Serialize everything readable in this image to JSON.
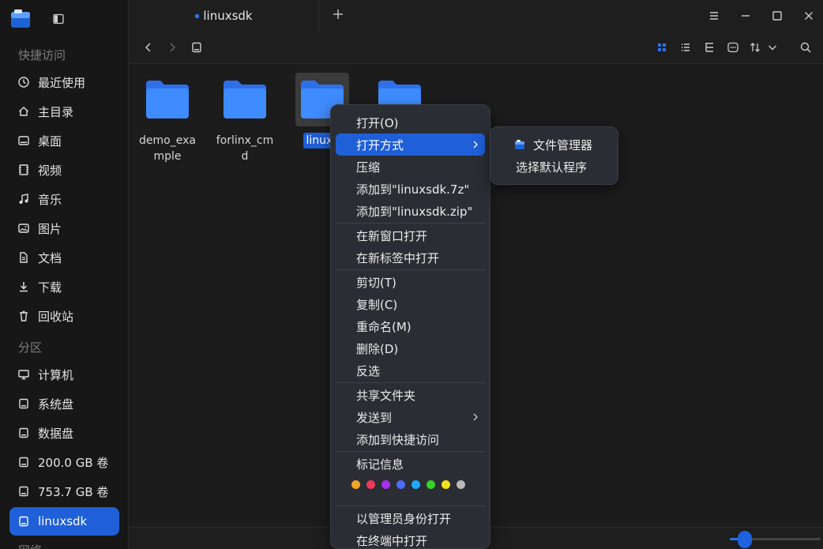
{
  "sidebar": {
    "section_quick": "快捷访问",
    "section_partition": "分区",
    "section_network": "网络",
    "quick_items": [
      {
        "label": "最近使用",
        "icon": "clock-icon"
      },
      {
        "label": "主目录",
        "icon": "home-icon"
      },
      {
        "label": "桌面",
        "icon": "desktop-icon"
      },
      {
        "label": "视频",
        "icon": "video-icon"
      },
      {
        "label": "音乐",
        "icon": "music-icon"
      },
      {
        "label": "图片",
        "icon": "image-icon"
      },
      {
        "label": "文档",
        "icon": "document-icon"
      },
      {
        "label": "下载",
        "icon": "download-icon"
      },
      {
        "label": "回收站",
        "icon": "trash-icon"
      }
    ],
    "partition_items": [
      {
        "label": "计算机",
        "icon": "computer-icon"
      },
      {
        "label": "系统盘",
        "icon": "disk-icon"
      },
      {
        "label": "数据盘",
        "icon": "disk-icon"
      },
      {
        "label": "200.0 GB 卷",
        "icon": "disk-icon"
      },
      {
        "label": "753.7 GB 卷",
        "icon": "disk-icon"
      },
      {
        "label": "linuxsdk",
        "icon": "disk-icon",
        "active": true
      }
    ]
  },
  "tab": {
    "label": "linuxsdk"
  },
  "files": [
    {
      "name": "demo_example"
    },
    {
      "name": "forlinx_cmd"
    },
    {
      "name": "linuxsdk",
      "display": "linuxs",
      "selected": true
    },
    {
      "name": ""
    }
  ],
  "context_menu": {
    "items": [
      "打开(O)",
      "打开方式",
      "压缩",
      "添加到\"linuxsdk.7z\"",
      "添加到\"linuxsdk.zip\"",
      "在新窗口打开",
      "在新标签中打开",
      "剪切(T)",
      "复制(C)",
      "重命名(M)",
      "删除(D)",
      "反选",
      "共享文件夹",
      "发送到",
      "添加到快捷访问",
      "标记信息",
      "以管理员身份打开",
      "在终端中打开"
    ],
    "tag_colors": [
      "#f5a623",
      "#ef3a5d",
      "#a52ff0",
      "#4f6bff",
      "#1fa8ff",
      "#37d22c",
      "#f2e21b",
      "#b9b9b9"
    ]
  },
  "submenu": {
    "items": [
      "文件管理器",
      "选择默认程序"
    ]
  },
  "colors": {
    "accent": "#1f5fd8",
    "folder": "#3a82f5"
  }
}
